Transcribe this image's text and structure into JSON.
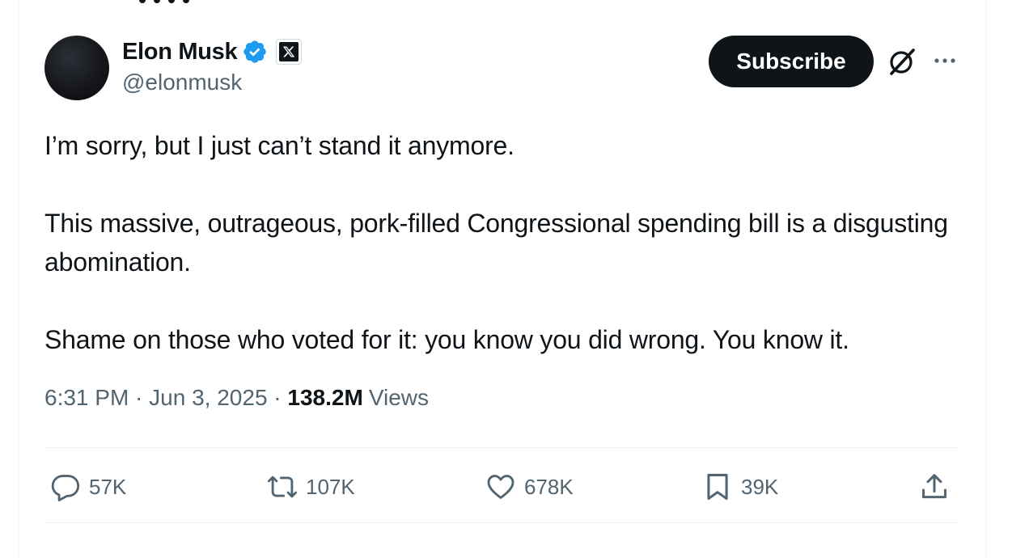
{
  "author": {
    "name": "Elon Musk",
    "handle": "@elonmusk",
    "verified_icon": "verified-badge-icon",
    "affiliate_badge": "x-logo-icon",
    "avatar": "avatar"
  },
  "header_actions": {
    "subscribe_label": "Subscribe",
    "grok_icon": "grok-icon",
    "more_icon": "more-icon"
  },
  "post": {
    "paragraphs": [
      "I’m sorry, but I just can’t stand it anymore.",
      "This massive, outrageous, pork-filled Congressional spending bill is a disgusting abomination.",
      "Shame on those who voted for it: you know you did wrong. You know it."
    ],
    "time": "6:31 PM",
    "separator": " · ",
    "date": "Jun 3, 2025",
    "views_count": "138.2M",
    "views_label": "Views"
  },
  "actions": {
    "reply": {
      "icon": "reply-icon",
      "count": "57K"
    },
    "repost": {
      "icon": "repost-icon",
      "count": "107K"
    },
    "like": {
      "icon": "heart-icon",
      "count": "678K"
    },
    "bookmark": {
      "icon": "bookmark-icon",
      "count": "39K"
    },
    "share": {
      "icon": "share-icon"
    }
  },
  "colors": {
    "text_primary": "#0f1419",
    "text_secondary": "#536471",
    "verified_blue": "#1d9bf0",
    "divider": "#eff3f4"
  }
}
